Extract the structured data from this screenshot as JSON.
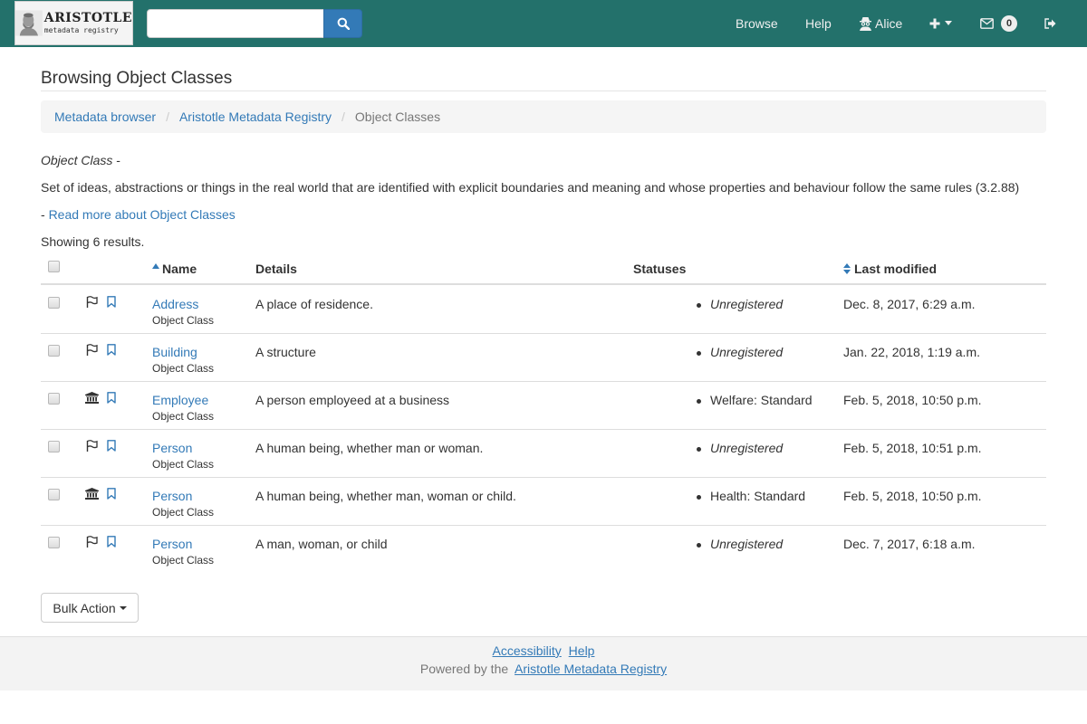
{
  "navbar": {
    "logo": {
      "title": "ARISTOTLE",
      "subtitle": "metadata registry"
    },
    "search": {
      "value": "",
      "placeholder": ""
    },
    "links": {
      "browse": "Browse",
      "help": "Help",
      "user": "Alice"
    },
    "inbox_count": "0",
    "icons": [
      "search-icon",
      "user-secret-icon",
      "plus-icon",
      "caret-down-icon",
      "envelope-icon",
      "sign-out-icon"
    ]
  },
  "page": {
    "title": "Browsing Object Classes",
    "breadcrumb": [
      "Metadata browser",
      "Aristotle Metadata Registry",
      "Object Classes"
    ],
    "definition_label": "Object Class",
    "definition_dash": " -",
    "definition": "Set of ideas, abstractions or things in the real world that are identified with explicit boundaries and meaning and whose properties and behaviour follow the same rules (3.2.88)",
    "read_more_prefix": "- ",
    "read_more": "Read more about Object Classes",
    "result_count": "Showing 6 results."
  },
  "table": {
    "headers": {
      "name": "Name",
      "details": "Details",
      "statuses": "Statuses",
      "modified": "Last modified"
    },
    "rows": [
      {
        "name": "Address",
        "type": "Object Class",
        "details": "A place of residence.",
        "status": "Unregistered",
        "status_italic": true,
        "modified": "Dec. 8, 2017, 6:29 a.m.",
        "icon": "flag-icon"
      },
      {
        "name": "Building",
        "type": "Object Class",
        "details": "A structure",
        "status": "Unregistered",
        "status_italic": true,
        "modified": "Jan. 22, 2018, 1:19 a.m.",
        "icon": "flag-icon"
      },
      {
        "name": "Employee",
        "type": "Object Class",
        "details": "A person employeed at a business",
        "status": "Welfare: Standard",
        "status_italic": false,
        "modified": "Feb. 5, 2018, 10:50 p.m.",
        "icon": "institution-icon"
      },
      {
        "name": "Person",
        "type": "Object Class",
        "details": "A human being, whether man or woman.",
        "status": "Unregistered",
        "status_italic": true,
        "modified": "Feb. 5, 2018, 10:51 p.m.",
        "icon": "flag-icon"
      },
      {
        "name": "Person",
        "type": "Object Class",
        "details": "A human being, whether man, woman or child.",
        "status": "Health: Standard",
        "status_italic": false,
        "modified": "Feb. 5, 2018, 10:50 p.m.",
        "icon": "institution-icon"
      },
      {
        "name": "Person",
        "type": "Object Class",
        "details": "A man, woman, or child",
        "status": "Unregistered",
        "status_italic": true,
        "modified": "Dec. 7, 2017, 6:18 a.m.",
        "icon": "flag-icon"
      }
    ]
  },
  "bulk_action": "Bulk Action",
  "footer": {
    "links": [
      "Accessibility",
      "Help"
    ],
    "powered_prefix": "Powered by the",
    "powered_link": "Aristotle Metadata Registry"
  },
  "colors": {
    "navbar": "#23716b",
    "link": "#337ab7",
    "search_button": "#337ab7"
  }
}
